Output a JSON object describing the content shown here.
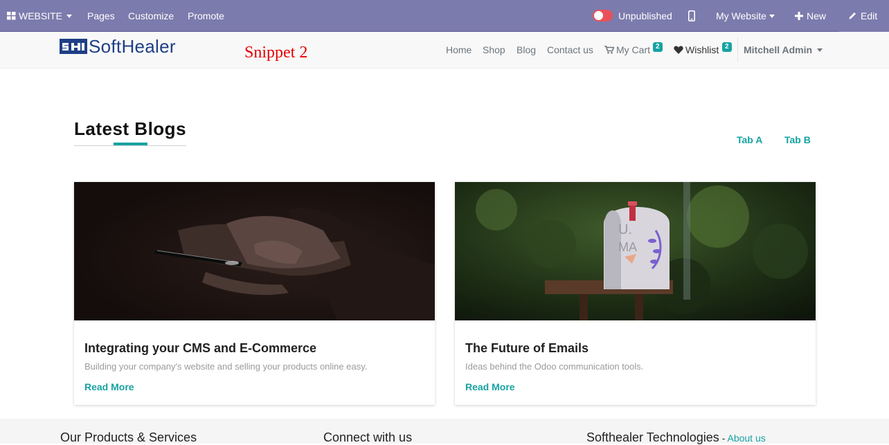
{
  "admin_bar": {
    "website_label": "WEBSITE",
    "pages": "Pages",
    "customize": "Customize",
    "promote": "Promote",
    "publish_status": "Unpublished",
    "website_select": "My Website",
    "new_label": "New",
    "edit_label": "Edit",
    "bg_color": "#7c7bad"
  },
  "header": {
    "logo_text": "SoftHealer",
    "snippet_label": "Snippet 2",
    "nav": [
      {
        "label": "Home"
      },
      {
        "label": "Shop"
      },
      {
        "label": "Blog"
      },
      {
        "label": "Contact us"
      },
      {
        "label": "My Cart",
        "badge": "2"
      },
      {
        "label": "Wishlist",
        "badge": "2"
      }
    ],
    "user": "Mitchell Admin"
  },
  "section": {
    "title": "Latest Blogs",
    "tabs": [
      "Tab A",
      "Tab B"
    ],
    "accent_color": "#17a2a2"
  },
  "posts": [
    {
      "title": "Integrating your CMS and E-Commerce",
      "subtitle": "Building your company's website and selling your products online easy.",
      "link": "Read More",
      "image": "hands-holding-phone-image"
    },
    {
      "title": "The Future of Emails",
      "subtitle": "Ideas behind the Odoo communication tools.",
      "link": "Read More",
      "image": "mailbox-image"
    }
  ],
  "footer": {
    "col1": "Our Products & Services",
    "col2": "Connect with us",
    "col3": "Softhealer Technologies",
    "col3_separator": " - ",
    "col3_link": "About us"
  }
}
